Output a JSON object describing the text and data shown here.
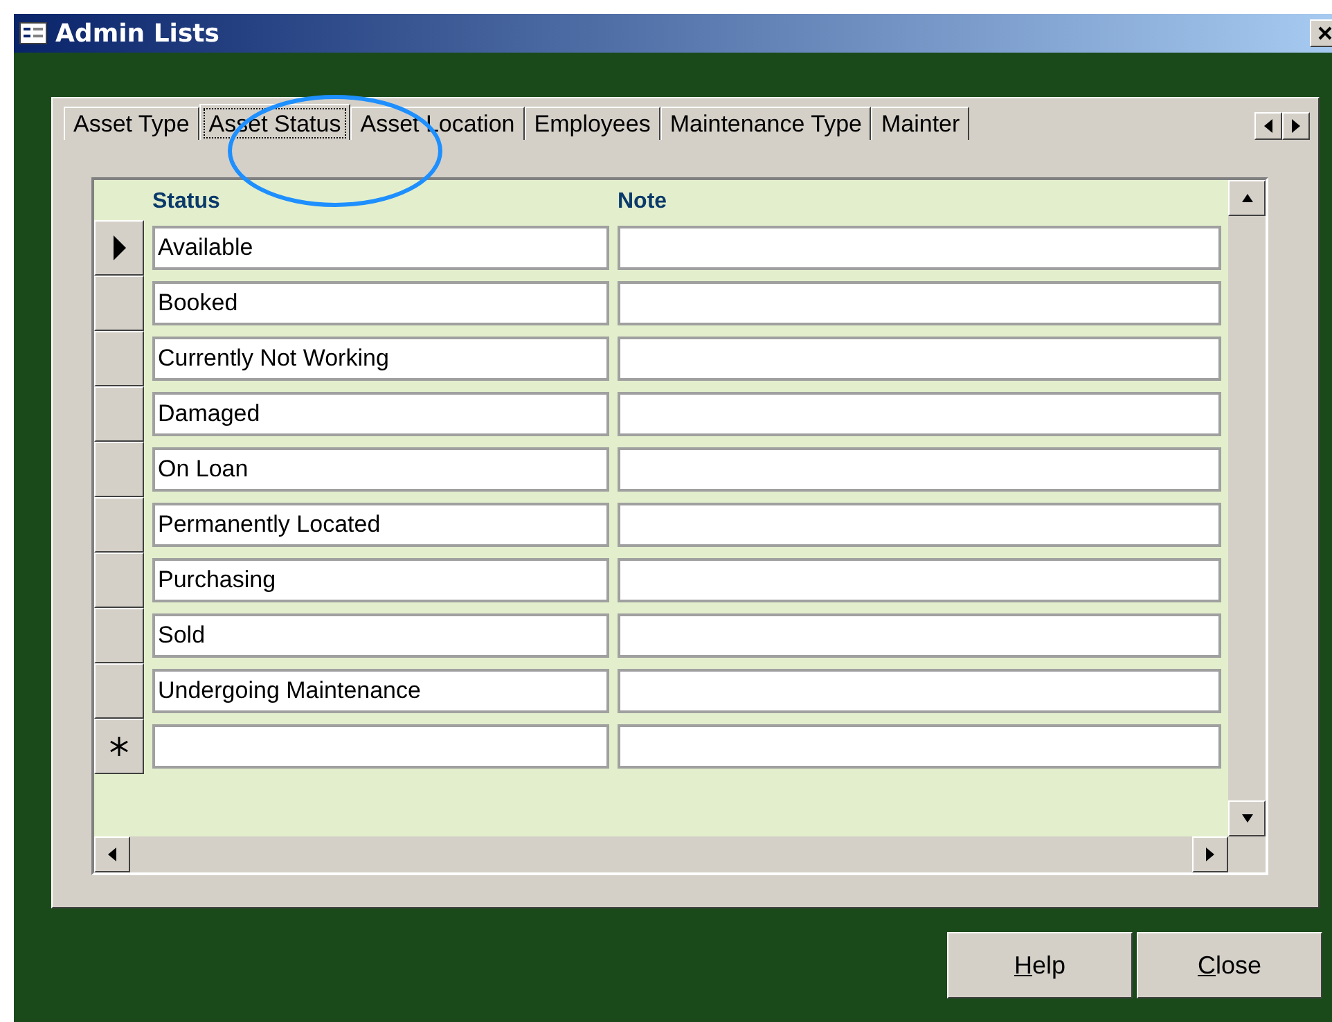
{
  "window": {
    "title": "Admin Lists"
  },
  "tabs": [
    {
      "label": "Asset Type",
      "selected": false
    },
    {
      "label": "Asset Status",
      "selected": true
    },
    {
      "label": "Asset Location",
      "selected": false
    },
    {
      "label": "Employees",
      "selected": false
    },
    {
      "label": "Maintenance Type",
      "selected": false
    },
    {
      "label": "Mainter",
      "selected": false
    }
  ],
  "table": {
    "columns": [
      "Status",
      "Note"
    ],
    "rows": [
      {
        "kind": "record",
        "current": true,
        "status": "Available"
      },
      {
        "kind": "record",
        "current": false,
        "status": "Booked"
      },
      {
        "kind": "record",
        "current": false,
        "status": "Currently Not Working"
      },
      {
        "kind": "record",
        "current": false,
        "status": "Damaged"
      },
      {
        "kind": "record",
        "current": false,
        "status": "On Loan"
      },
      {
        "kind": "record",
        "current": false,
        "status": "Permanently Located"
      },
      {
        "kind": "record",
        "current": false,
        "status": "Purchasing"
      },
      {
        "kind": "record",
        "current": false,
        "status": "Sold"
      },
      {
        "kind": "record",
        "current": false,
        "status": "Undergoing Maintenance"
      },
      {
        "kind": "new"
      }
    ]
  },
  "buttons": [
    "Help",
    "Close"
  ]
}
